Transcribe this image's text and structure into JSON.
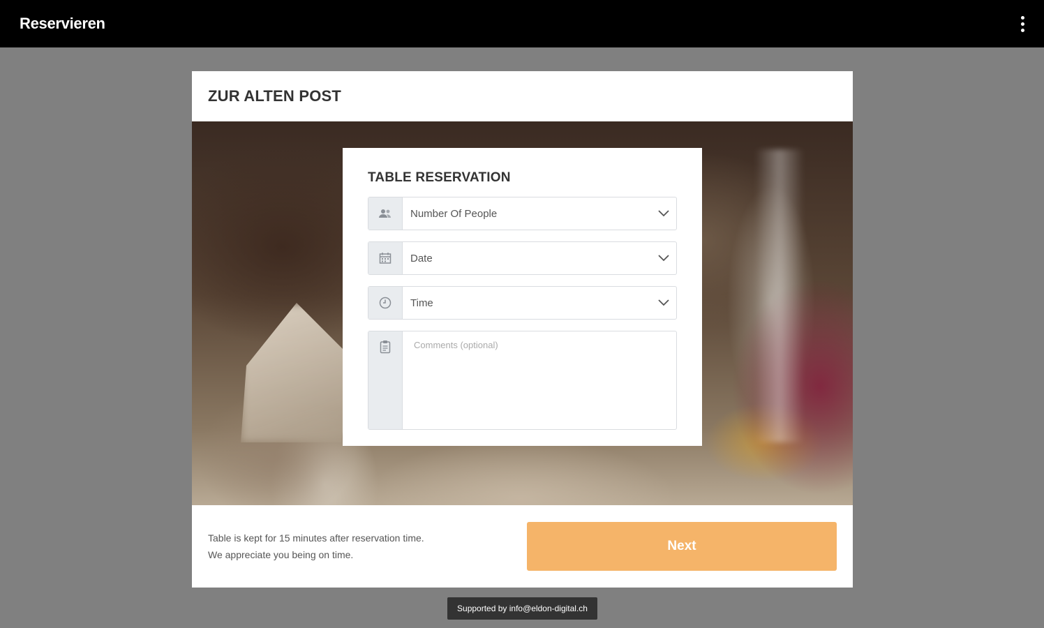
{
  "appbar": {
    "title": "Reservieren",
    "menu_icon": "more-vertical-icon"
  },
  "restaurant": {
    "name": "ZUR ALTEN POST"
  },
  "form": {
    "title": "TABLE RESERVATION",
    "people": {
      "value": "Number Of People",
      "icon": "people-icon"
    },
    "date": {
      "value": "Date",
      "icon": "calendar-icon"
    },
    "time": {
      "value": "Time",
      "icon": "clock-icon"
    },
    "comments": {
      "placeholder": "Comments (optional)",
      "icon": "clipboard-icon"
    }
  },
  "footer": {
    "notice_line1": "Table is kept for 15 minutes after reservation time.",
    "notice_line2": "We appreciate you being on time.",
    "next_label": "Next"
  },
  "support": {
    "text": "Supported by info@eldon-digital.ch"
  },
  "colors": {
    "appbar": "#000000",
    "page_background": "#808080",
    "next_button": "#f5b469"
  }
}
